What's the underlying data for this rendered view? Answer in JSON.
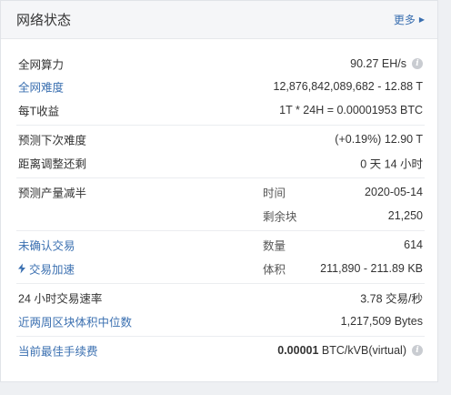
{
  "header": {
    "title": "网络状态",
    "more": "更多"
  },
  "hashrate": {
    "label": "全网算力",
    "value": "90.27 EH/s"
  },
  "difficulty": {
    "label": "全网难度",
    "value": "12,876,842,089,682 - 12.88 T"
  },
  "income": {
    "label": "每T收益",
    "value": "1T * 24H = 0.00001953 BTC"
  },
  "next_difficulty": {
    "label": "预测下次难度",
    "value": "(+0.19%) 12.90 T"
  },
  "adjust_remaining": {
    "label": "距离调整还剩",
    "value": "0 天 14 小时"
  },
  "halving": {
    "label": "预测产量减半",
    "time_label": "时间",
    "time_value": "2020-05-14",
    "blocks_label": "剩余块",
    "blocks_value": "21,250"
  },
  "unconfirmed": {
    "label": "未确认交易",
    "sub": "数量",
    "value": "614"
  },
  "accelerate": {
    "label": "交易加速",
    "sub": "体积",
    "value": "211,890 - 211.89 KB"
  },
  "tx_rate": {
    "label": "24 小时交易速率",
    "value": "3.78 交易/秒"
  },
  "median_block": {
    "label": "近两周区块体积中位数",
    "value": "1,217,509 Bytes"
  },
  "fee": {
    "label": "当前最佳手续费",
    "value_bold": "0.00001",
    "value_unit": "BTC/kVB(virtual)"
  },
  "colors": {
    "link": "#3a6fb0",
    "text": "#333333",
    "header_bg": "#f5f6f8",
    "separator": "#ebedf0"
  },
  "icons": {
    "info": "info-icon",
    "bolt": "lightning-bolt-icon",
    "arrow": "chevron-right-icon"
  }
}
